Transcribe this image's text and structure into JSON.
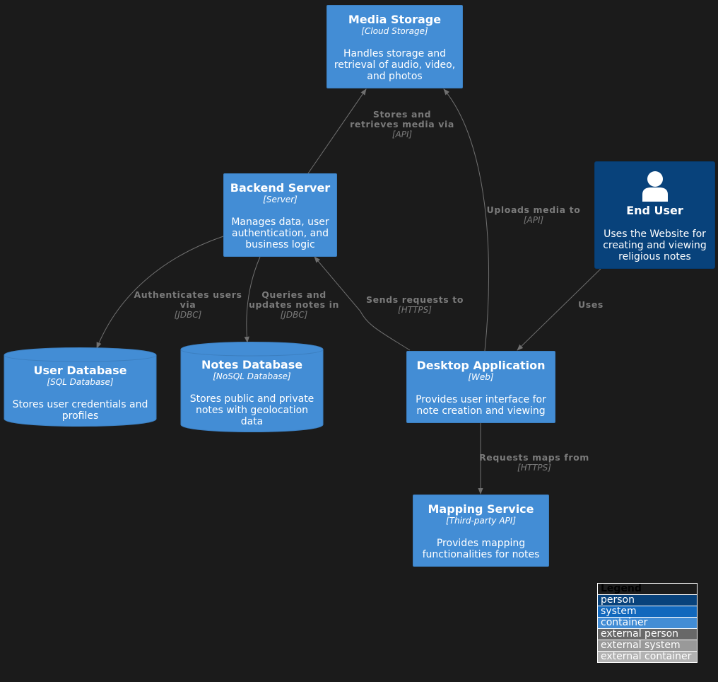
{
  "nodes": {
    "media_storage": {
      "title": "Media Storage",
      "tech": "[Cloud Storage]",
      "desc": "Handles storage and retrieval of audio, video, and photos"
    },
    "backend_server": {
      "title": "Backend Server",
      "tech": "[Server]",
      "desc": "Manages data, user authentication, and business logic"
    },
    "end_user": {
      "title": "End User",
      "desc": "Uses the Website for creating and viewing religious notes"
    },
    "user_database": {
      "title": "User Database",
      "tech": "[SQL Database]",
      "desc": "Stores user credentials and profiles"
    },
    "notes_database": {
      "title": "Notes Database",
      "tech": "[NoSQL Database]",
      "desc": "Stores public and private notes with geolocation data"
    },
    "desktop_app": {
      "title": "Desktop Application",
      "tech": "[Web]",
      "desc": "Provides user interface for note creation and viewing"
    },
    "mapping_service": {
      "title": "Mapping Service",
      "tech": "[Third-party API]",
      "desc": "Provides mapping functionalities for notes"
    }
  },
  "edges": {
    "backend_to_media": {
      "label": "Stores and retrieves media via",
      "tech": "[API]"
    },
    "app_to_media": {
      "label": "Uploads media to",
      "tech": "[API]"
    },
    "backend_to_userdb": {
      "label": "Authenticates users via",
      "tech": "[JDBC]"
    },
    "backend_to_notesdb": {
      "label": "Queries and updates notes in",
      "tech": "[JDBC]"
    },
    "app_to_backend": {
      "label": "Sends requests to",
      "tech": "[HTTPS]"
    },
    "user_to_app": {
      "label": "Uses"
    },
    "app_to_mapping": {
      "label": "Requests maps from",
      "tech": "[HTTPS]"
    }
  },
  "legend": {
    "title": "Legend",
    "items": [
      {
        "label": "person",
        "color": "#08427b"
      },
      {
        "label": "system",
        "color": "#1168bd"
      },
      {
        "label": "container",
        "color": "#438dd5"
      },
      {
        "label": "external person",
        "color": "#686868"
      },
      {
        "label": "external system",
        "color": "#999999"
      },
      {
        "label": "external container",
        "color": "#b3b3b3"
      }
    ]
  },
  "colors": {
    "background": "#1b1b1b",
    "container": "#438dd5",
    "person": "#08427b",
    "edge": "#707070",
    "edge_label": "#7a7a7a"
  }
}
